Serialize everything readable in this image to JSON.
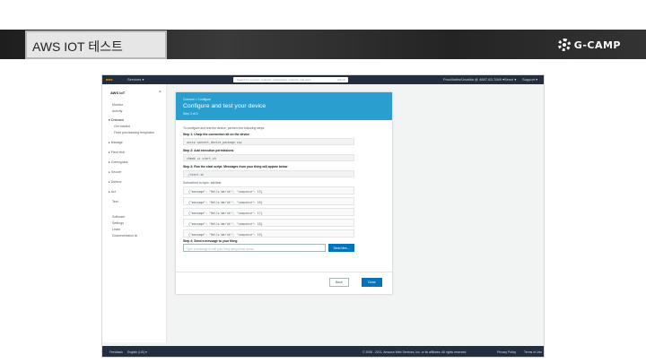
{
  "slide": {
    "title": "AWS IOT 테스트",
    "brand": "G-CAMP"
  },
  "console": {
    "nav": {
      "services": "Services ▾",
      "search_placeholder": "Search for services, features, marketplace products, and docs",
      "search_shortcut": "[Alt+S]",
      "account": "ProcMaths/Unabila @ 4887-63-7849 ▾",
      "region": "Seoul ▾",
      "support": "Support ▾"
    },
    "sidebar": {
      "title": "AWS IoT",
      "close": "×",
      "items": [
        "Monitor",
        "Activity",
        "▾ Onboard",
        "Get started",
        "Fleet provisioning templates",
        "▸ Manage",
        "▸ Fleet Hub",
        "▸ Greengrass",
        "▸ Secure",
        "▸ Defend",
        "▸ Act",
        "Test",
        "Software",
        "Settings",
        "Learn",
        "Documentation ⧉"
      ]
    },
    "dialog": {
      "breadcrumb": "Connect > Configure",
      "title": "Configure and test your device",
      "step": "Step 3 of 3",
      "intro": "To configure and test the device, perform the following steps.",
      "step1": "Step 1: Unzip the connection kit on the device",
      "code1": "unzip connect_device_package.zip",
      "step2": "Step 2: Add execution permissions",
      "code2": "chmod +x start.sh",
      "step3": "Step 3: Run the start script. Messages from your thing will appear below",
      "code3": "./start.sh",
      "subscribed": "Subscribed to topic: sdk/test",
      "messages": [
        "{\"message\": \"Hello World!\", \"sequence\": 15}",
        "{\"message\": \"Hello World!\", \"sequence\": 16}",
        "{\"message\": \"Hello World!\", \"sequence\": 17}",
        "{\"message\": \"Hello World!\", \"sequence\": 18}",
        "{\"message\": \"Hello World!\", \"sequence\": 19}"
      ],
      "step4": "Step 4: Send a message to your thing",
      "input_placeholder": "Type a message or edit your thing using these words",
      "send_label": "Send Mes...",
      "back_label": "Back",
      "done_label": "Done"
    },
    "footer": {
      "feedback": "Feedback",
      "language": "English (US) ▾",
      "copyright": "© 2008 - 2021, Amazon Web Services, Inc. or its affiliates. All rights reserved.",
      "privacy": "Privacy Policy",
      "terms": "Terms of Use"
    }
  }
}
